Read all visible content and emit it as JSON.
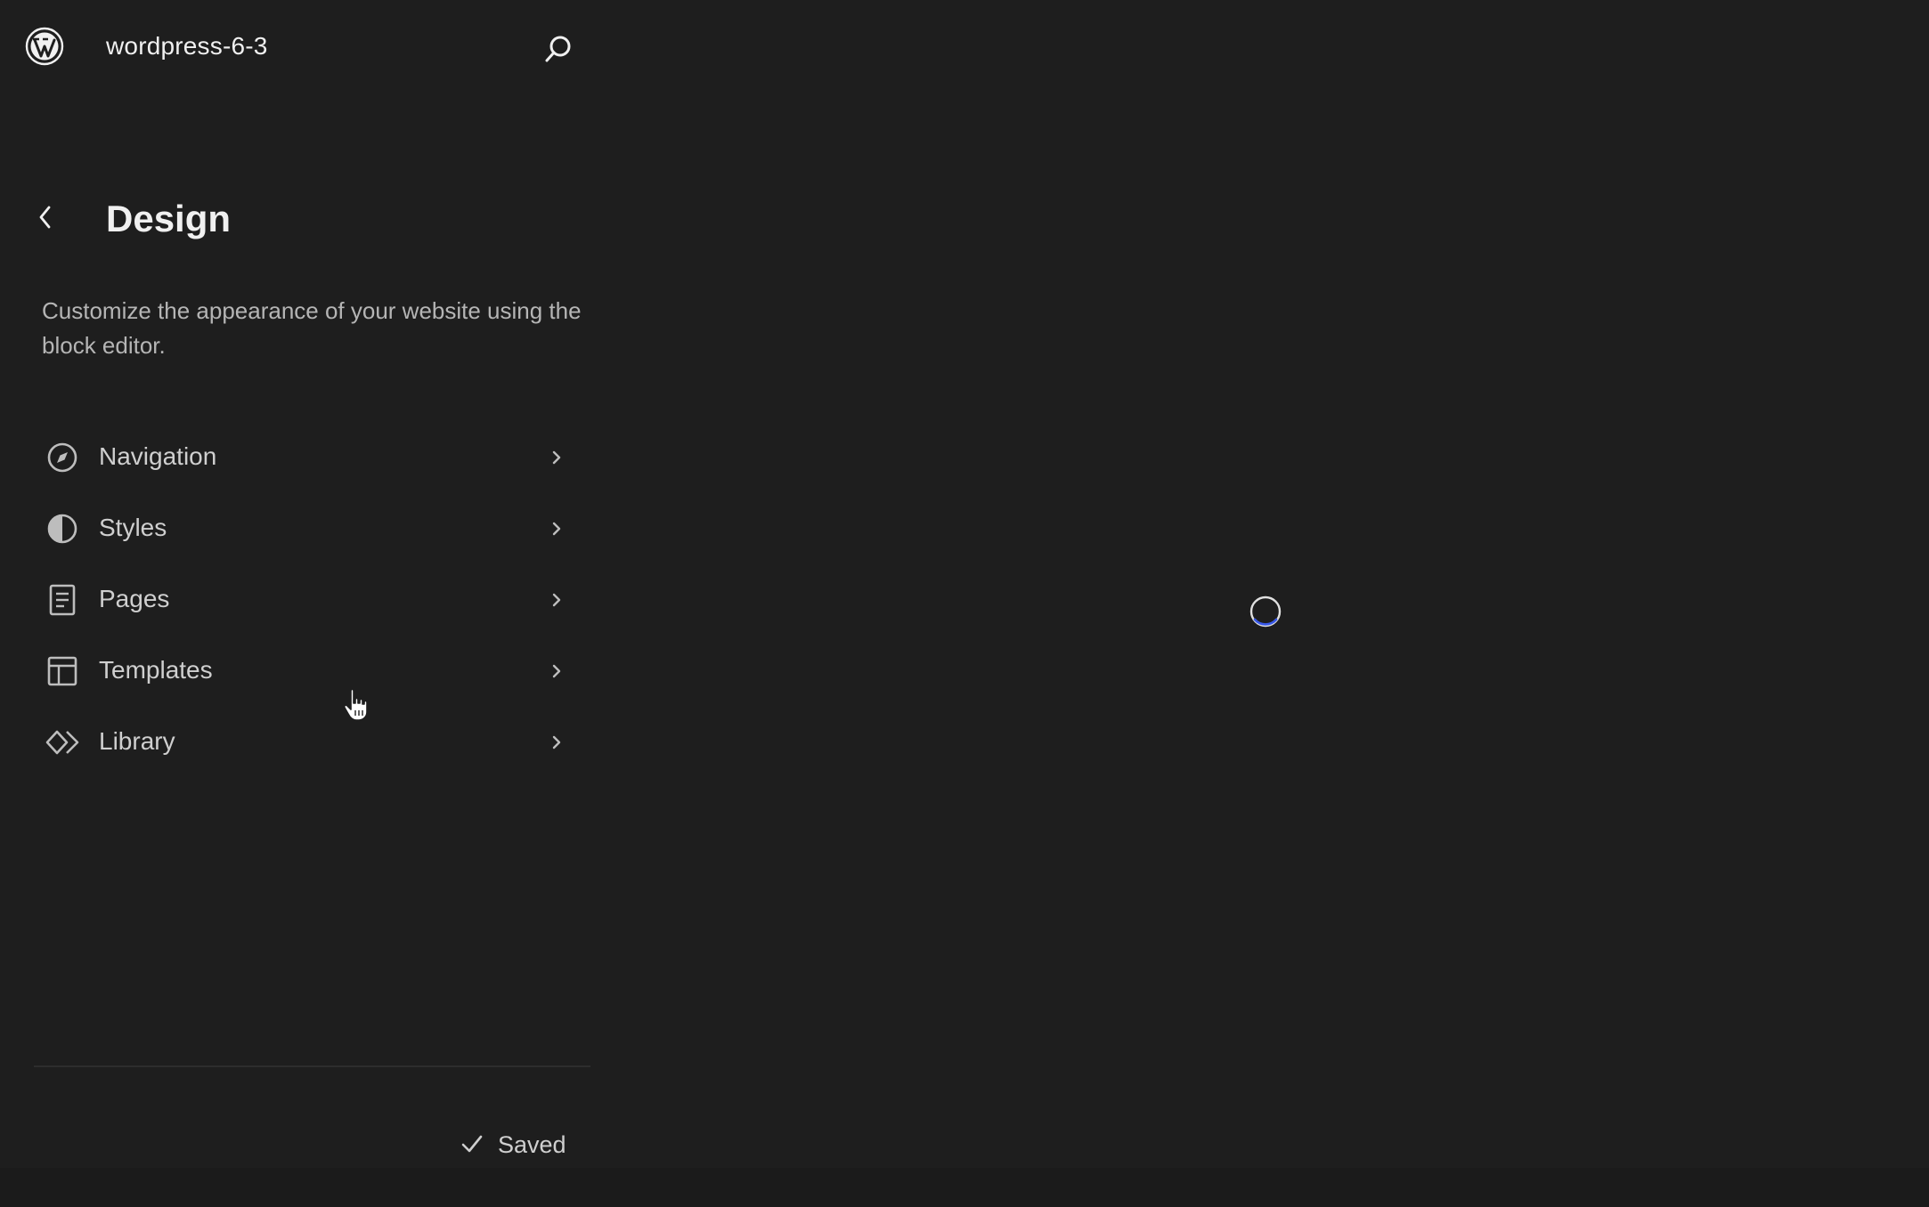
{
  "site_hub": {
    "site_title": "wordpress-6-3",
    "logo_icon": "wordpress-logo-icon",
    "search_icon": "search-icon"
  },
  "navigator": {
    "back_icon": "chevron-left-icon",
    "title": "Design",
    "description": "Customize the appearance of your website using the block editor."
  },
  "menu": {
    "items": [
      {
        "label": "Navigation",
        "icon": "navigation-compass-icon"
      },
      {
        "label": "Styles",
        "icon": "styles-half-circle-icon"
      },
      {
        "label": "Pages",
        "icon": "page-icon"
      },
      {
        "label": "Templates",
        "icon": "layout-icon"
      },
      {
        "label": "Library",
        "icon": "symbol-icon"
      }
    ],
    "chevron_icon": "chevron-right-icon"
  },
  "footer": {
    "status_label": "Saved",
    "status_icon": "check-icon"
  },
  "canvas": {
    "state_icon": "spinner-icon"
  },
  "colors": {
    "background": "#1e1e1e",
    "text_primary": "#f0f0f0",
    "text_secondary": "#b5b5b5",
    "spinner_accent": "#3858e9"
  }
}
